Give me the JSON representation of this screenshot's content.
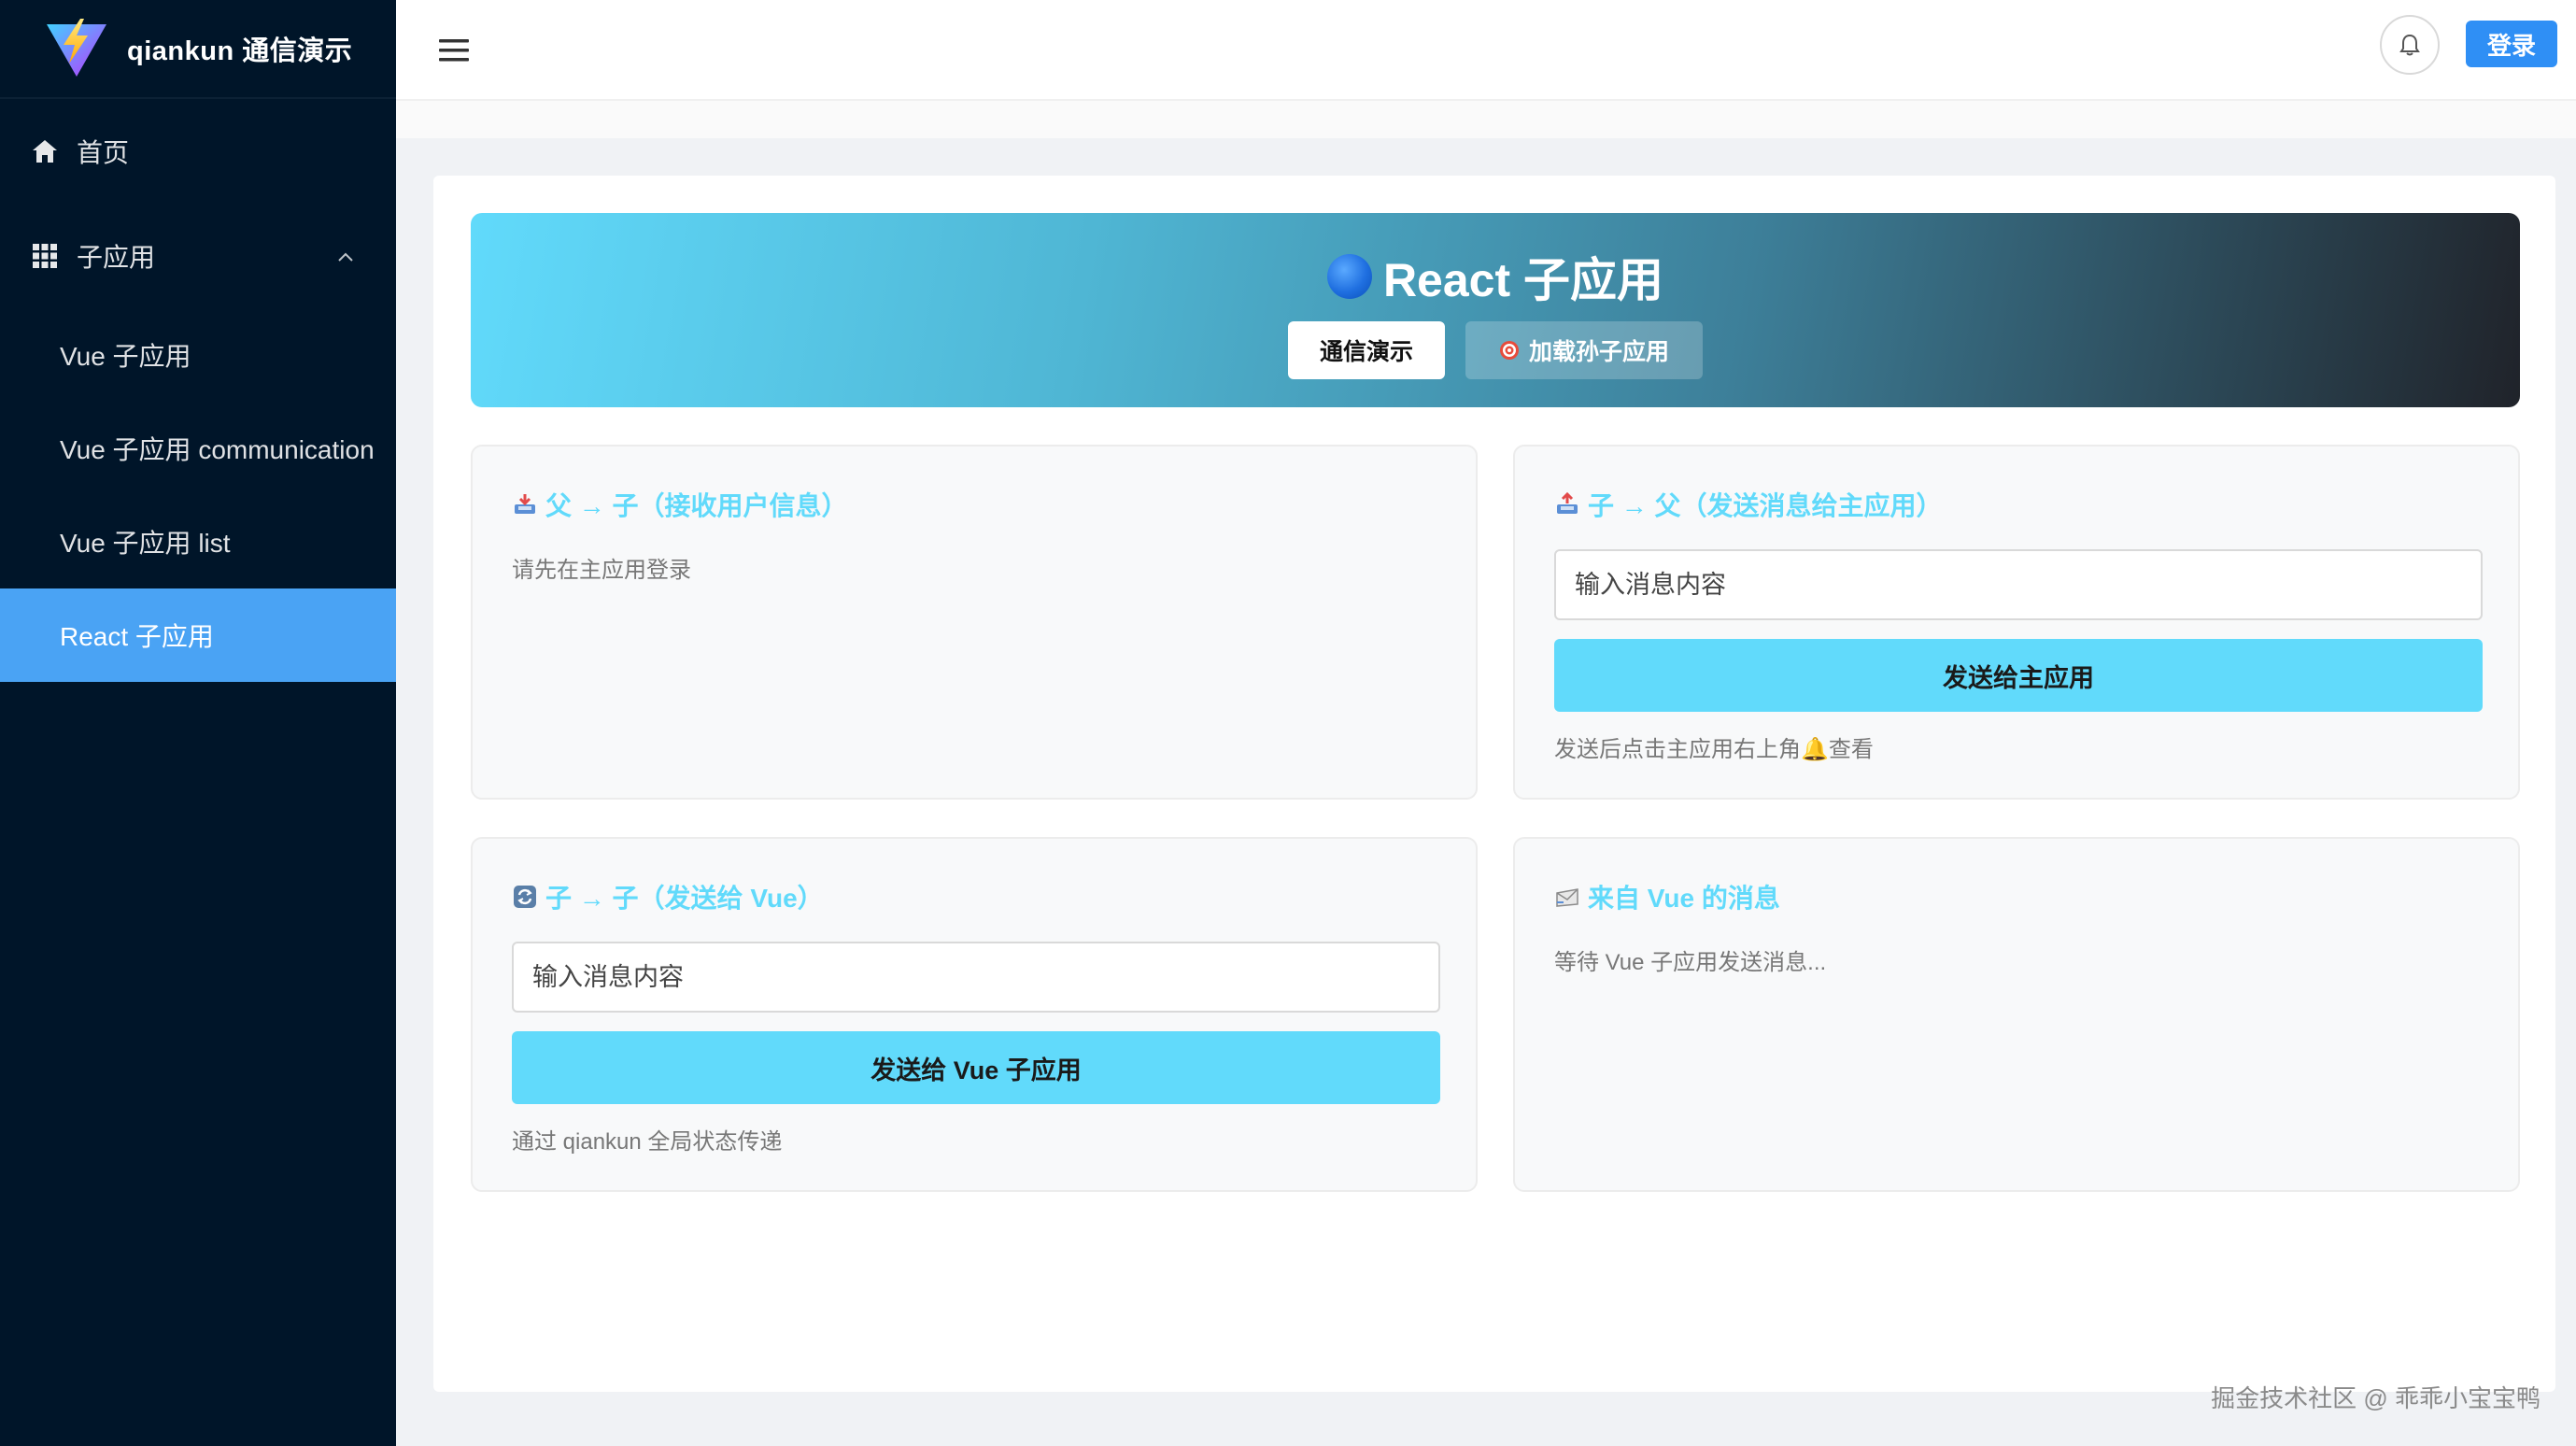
{
  "sidebar": {
    "brand": "qiankun 通信演示",
    "home_label": "首页",
    "group_label": "子应用",
    "sub_items": [
      {
        "label": "Vue 子应用"
      },
      {
        "label": "Vue 子应用 communication"
      },
      {
        "label": "Vue 子应用 list"
      },
      {
        "label": "React 子应用"
      }
    ]
  },
  "header": {
    "login_label": "登录"
  },
  "banner": {
    "title": "React 子应用",
    "demo_button": "通信演示",
    "load_button": "加载孙子应用"
  },
  "cards": {
    "parent_to_child": {
      "title": "父 → 子（接收用户信息）",
      "text": "请先在主应用登录"
    },
    "child_to_parent": {
      "title": "子 → 父（发送消息给主应用）",
      "placeholder": "输入消息内容",
      "button": "发送给主应用",
      "hint": "发送后点击主应用右上角🔔查看"
    },
    "child_to_child": {
      "title": "子 → 子（发送给 Vue）",
      "placeholder": "输入消息内容",
      "button": "发送给 Vue 子应用",
      "hint": "通过 qiankun 全局状态传递"
    },
    "from_vue": {
      "title": "来自 Vue 的消息",
      "text": "等待 Vue 子应用发送消息..."
    }
  },
  "watermark": "掘金技术社区 @ 乖乖小宝宝鸭",
  "colors": {
    "sidebar_bg": "#001529",
    "active_item": "#4aa3f4",
    "react_accent": "#61dafb",
    "primary": "#2f8ff5"
  }
}
